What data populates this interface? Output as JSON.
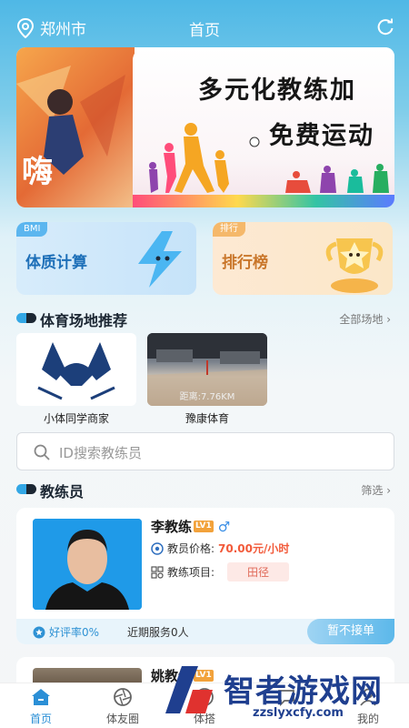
{
  "header": {
    "location": "郑州市",
    "title": "首页"
  },
  "banner": {
    "left_text": "嗨",
    "line1": "多元化教练加",
    "line2": "免费运动"
  },
  "feature_cards": [
    {
      "tag": "BMI",
      "label": "体质计算"
    },
    {
      "tag": "排行",
      "label": "排行榜"
    }
  ],
  "venues_section": {
    "title": "体育场地推荐",
    "more": "全部场地",
    "items": [
      {
        "name": "小体同学商家",
        "distance": ""
      },
      {
        "name": "豫康体育",
        "distance": "距离:7.76KM"
      }
    ]
  },
  "search": {
    "placeholder": "ID搜索教练员"
  },
  "coaches_section": {
    "title": "教练员",
    "filter": "筛选"
  },
  "coaches": [
    {
      "name": "李教练",
      "level": "LV1",
      "gender_symbol": "♂",
      "price_label": "教员价格:",
      "price": "70.00元/小时",
      "project_label": "教练项目:",
      "project": "田径",
      "rating": "好评率0%",
      "recent": "近期服务0人",
      "status": "暂不接单"
    },
    {
      "name": "姚教练",
      "level": "LV1"
    }
  ],
  "tabbar": [
    {
      "label": "首页",
      "icon": "home-icon",
      "active": true
    },
    {
      "label": "体友圈",
      "icon": "camera-aperture-icon",
      "active": false
    },
    {
      "label": "体搭",
      "icon": "plus-icon",
      "active": false
    },
    {
      "label": "",
      "icon": "message-icon",
      "active": false
    },
    {
      "label": "我的",
      "icon": "user-icon",
      "active": false
    }
  ],
  "watermark": {
    "title": "智者游戏网",
    "url": "zzslyxcfy.com"
  },
  "colors": {
    "primary": "#2b8fd6",
    "price": "#f25a3a"
  }
}
